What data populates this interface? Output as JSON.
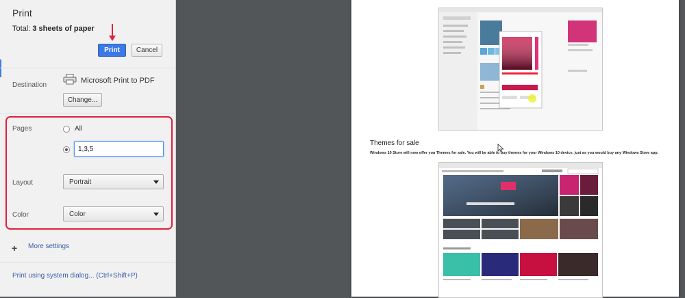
{
  "header": {
    "title": "Print",
    "total_label": "Total:",
    "total_value": "3 sheets of paper",
    "print_button": "Print",
    "cancel_button": "Cancel"
  },
  "destination": {
    "label": "Destination",
    "printer_name": "Microsoft Print to PDF",
    "change_button": "Change..."
  },
  "pages": {
    "label": "Pages",
    "option_all": "All",
    "custom_value": "1,3,5"
  },
  "layout": {
    "label": "Layout",
    "selected": "Portrait"
  },
  "color": {
    "label": "Color",
    "selected": "Color"
  },
  "more_settings": {
    "icon": "+",
    "label": "More settings"
  },
  "system_dialog_link": "Print using system dialog... (Ctrl+Shift+P)",
  "preview": {
    "heading": "Themes for sale",
    "body": "Windows 10 Store will now offer you Themes for sale. You will be able to buy themes for your Windows 10 device, just as you would buy any Windows Store app."
  },
  "colors": {
    "accent": "#3b7ae6",
    "highlight": "#e01e3c",
    "preview_background": "#525659"
  }
}
